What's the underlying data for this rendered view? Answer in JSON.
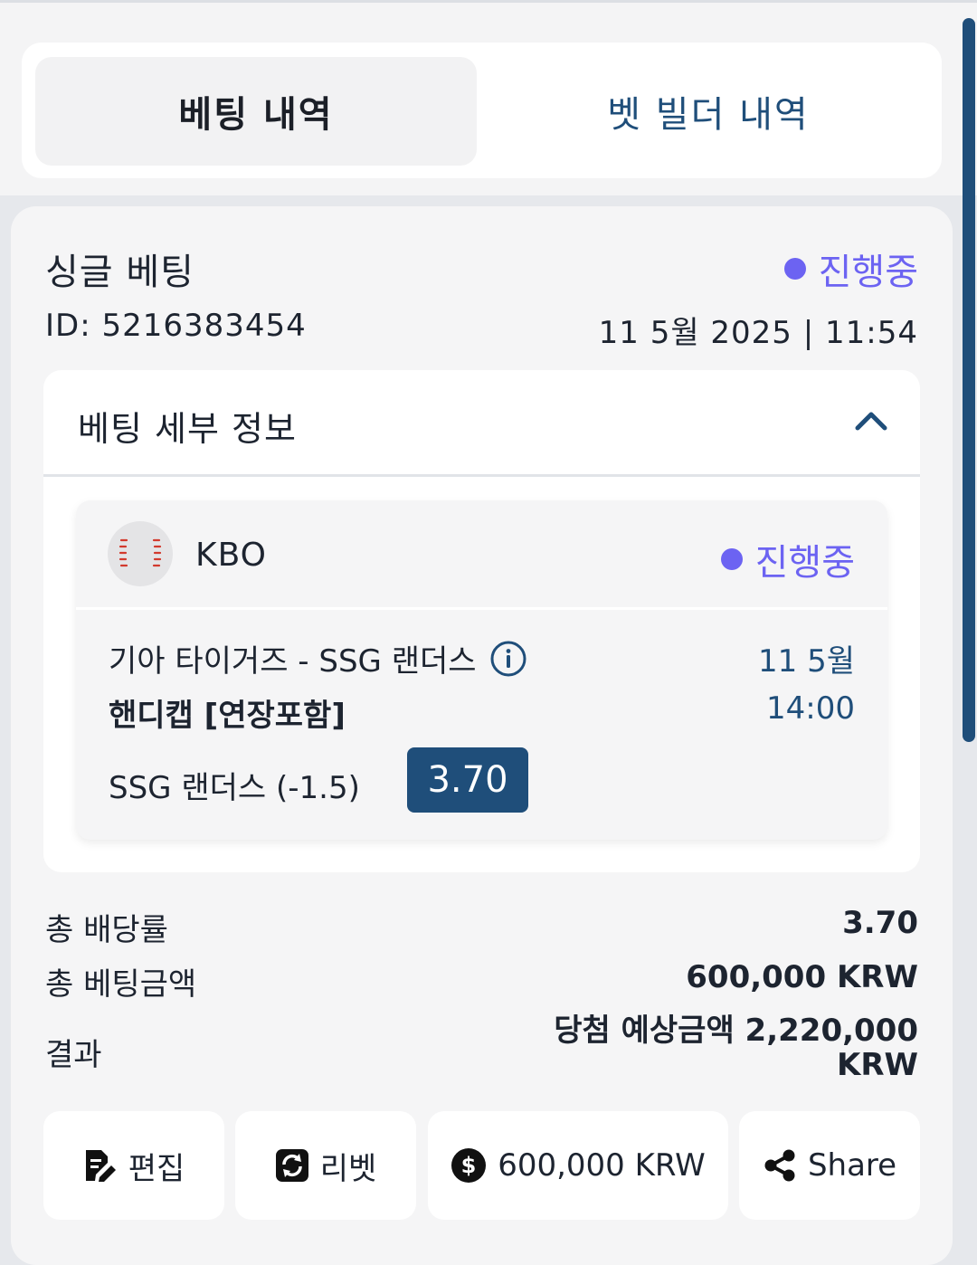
{
  "tabs": {
    "active": "베팅 내역",
    "inactive": "벳 빌더 내역"
  },
  "bet": {
    "type": "싱글 베팅",
    "status": "진행중",
    "id": "ID: 5216383454",
    "datetime": "11 5월 2025 | 11:54"
  },
  "details": {
    "title": "베팅 세부 정보",
    "league": "KBO",
    "league_status": "진행중",
    "teams": "기아 타이거즈 - SSG 랜더스",
    "market": "핸디캡 [연장포함]",
    "selection": "SSG 랜더스 (-1.5)",
    "odds": "3.70",
    "date": "11 5월",
    "time": "14:00"
  },
  "summary": {
    "total_odds_label": "총 배당률",
    "total_odds_value": "3.70",
    "total_stake_label": "총 베팅금액",
    "total_stake_value": "600,000 KRW",
    "result_label": "결과",
    "result_value_line1": "당첨 예상금액 2,220,000",
    "result_value_line2": "KRW"
  },
  "actions": {
    "edit": "편집",
    "rebet": "리벳",
    "amount": "600,000 KRW",
    "share": "Share"
  },
  "colors": {
    "accent": "#1f4e7a",
    "status": "#6c63f2"
  },
  "icons": [
    "chevron-up-icon",
    "baseball-icon",
    "info-icon",
    "edit-icon",
    "rebet-icon",
    "dollar-icon",
    "share-icon"
  ]
}
